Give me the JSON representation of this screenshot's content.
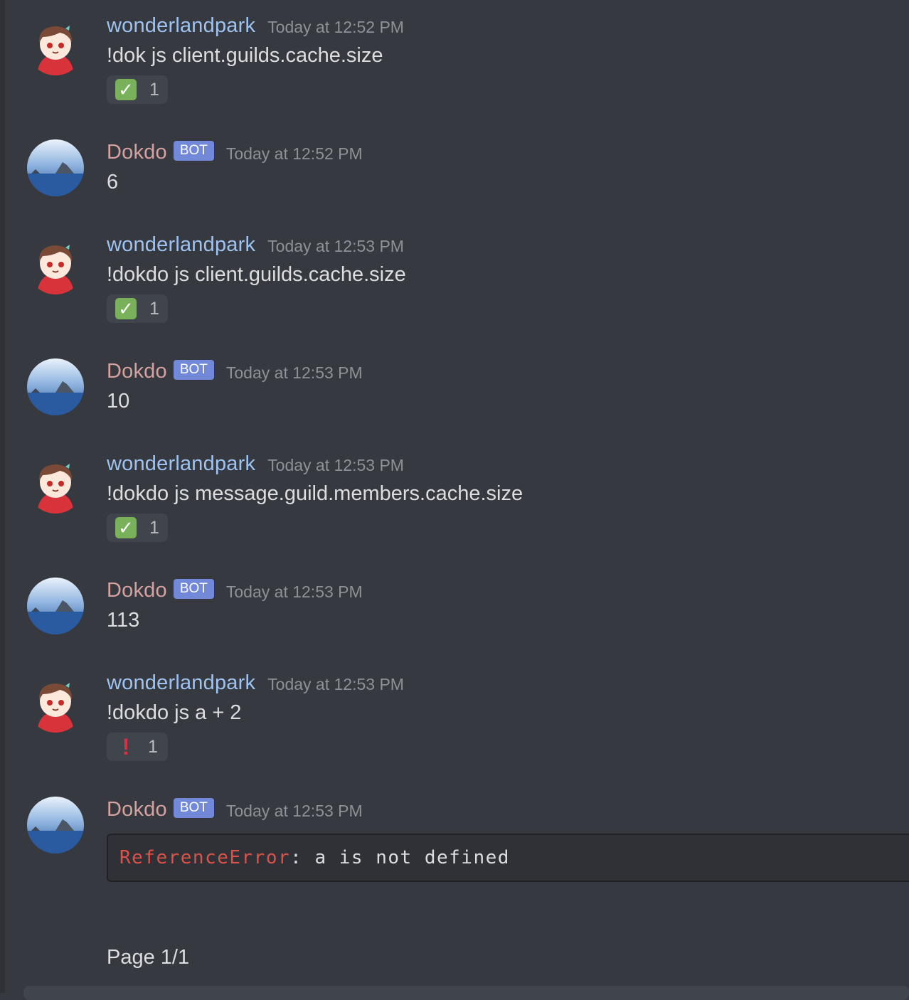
{
  "messages": [
    {
      "author": "wonderlandpark",
      "bot": false,
      "timestamp": "Today at 12:52 PM",
      "text": "!dok js client.guilds.cache.size",
      "reaction": {
        "emoji": "check-mark",
        "glyph": "✓",
        "count": "1"
      }
    },
    {
      "author": "Dokdo",
      "bot": true,
      "bot_tag": "BOT",
      "timestamp": "Today at 12:52 PM",
      "text": "6"
    },
    {
      "author": "wonderlandpark",
      "bot": false,
      "timestamp": "Today at 12:53 PM",
      "text": "!dokdo js client.guilds.cache.size",
      "reaction": {
        "emoji": "check-mark",
        "glyph": "✓",
        "count": "1"
      }
    },
    {
      "author": "Dokdo",
      "bot": true,
      "bot_tag": "BOT",
      "timestamp": "Today at 12:53 PM",
      "text": "10"
    },
    {
      "author": "wonderlandpark",
      "bot": false,
      "timestamp": "Today at 12:53 PM",
      "text": "!dokdo js message.guild.members.cache.size",
      "reaction": {
        "emoji": "check-mark",
        "glyph": "✓",
        "count": "1"
      }
    },
    {
      "author": "Dokdo",
      "bot": true,
      "bot_tag": "BOT",
      "timestamp": "Today at 12:53 PM",
      "text": "113"
    },
    {
      "author": "wonderlandpark",
      "bot": false,
      "timestamp": "Today at 12:53 PM",
      "text": "!dokdo js a + 2",
      "reaction": {
        "emoji": "exclamation-mark",
        "glyph": "!",
        "count": "1"
      }
    },
    {
      "author": "Dokdo",
      "bot": true,
      "bot_tag": "BOT",
      "timestamp": "Today at 12:53 PM",
      "code": {
        "error_name": "ReferenceError",
        "rest": ": a is not defined"
      }
    }
  ],
  "footer": {
    "page_label": "Page 1/1"
  },
  "colors": {
    "background": "#36393f",
    "user_name": "#9fc3f0",
    "bot_name": "#d6a1a0",
    "bot_tag": "#7289da",
    "check_emoji": "#78b159",
    "exclamation_emoji": "#dd2e44",
    "error_text": "#dc5149"
  }
}
